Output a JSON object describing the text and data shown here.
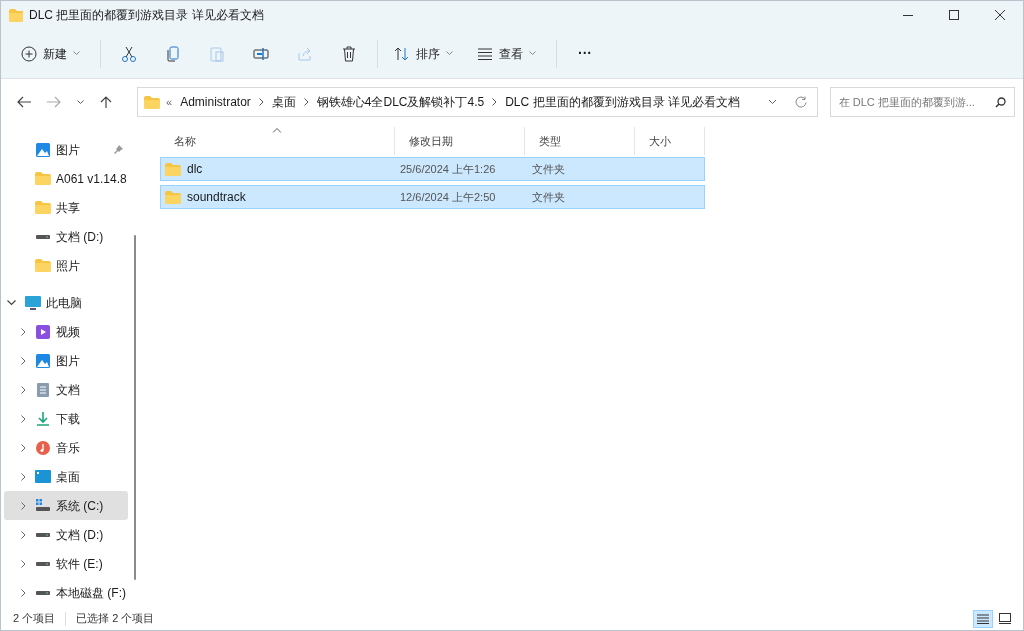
{
  "window": {
    "title": "DLC 把里面的都覆到游戏目录 详见必看文档"
  },
  "toolbar": [
    {
      "kind": "new",
      "label": "新建",
      "dropdown": true,
      "disabled": false
    },
    {
      "kind": "cut",
      "disabled": false
    },
    {
      "kind": "copy",
      "disabled": false
    },
    {
      "kind": "paste",
      "disabled": true
    },
    {
      "kind": "rename",
      "disabled": false
    },
    {
      "kind": "share",
      "disabled": true
    },
    {
      "kind": "delete",
      "disabled": false
    },
    {
      "kind": "sort",
      "label": "排序",
      "dropdown": true,
      "disabled": false
    },
    {
      "kind": "view",
      "label": "查看",
      "dropdown": true,
      "disabled": false
    },
    {
      "kind": "more",
      "label": "···",
      "disabled": false
    }
  ],
  "navigation": {
    "back_disabled": false,
    "forward_disabled": true
  },
  "address_bar": {
    "overflow": "«",
    "crumbs": [
      "Administrator",
      "桌面",
      "钢铁雄心4全DLC及解锁补丁4.5",
      "DLC 把里面的都覆到游戏目录 详见必看文档"
    ]
  },
  "search": {
    "placeholder": "在 DLC 把里面的都覆到游..."
  },
  "sidebar": {
    "quick_access": [
      {
        "kind": "pictures",
        "label": "图片",
        "pinned": true
      },
      {
        "kind": "folder",
        "label": "A061 v1.14.8",
        "pinned": false
      },
      {
        "kind": "folder",
        "label": "共享",
        "pinned": false
      },
      {
        "kind": "drive",
        "label": "文档 (D:)",
        "pinned": false
      },
      {
        "kind": "folder",
        "label": "照片",
        "pinned": false
      }
    ],
    "tree": [
      {
        "kind": "pc",
        "label": "此电脑",
        "expanded": true,
        "selected": false,
        "children": [
          {
            "kind": "videos",
            "label": "视频",
            "expanded": false,
            "selected": false
          },
          {
            "kind": "pictures",
            "label": "图片",
            "expanded": false,
            "selected": false
          },
          {
            "kind": "documents",
            "label": "文档",
            "expanded": false,
            "selected": false
          },
          {
            "kind": "downloads",
            "label": "下载",
            "expanded": false,
            "selected": false
          },
          {
            "kind": "music",
            "label": "音乐",
            "expanded": false,
            "selected": false
          },
          {
            "kind": "desktop",
            "label": "桌面",
            "expanded": false,
            "selected": false
          },
          {
            "kind": "system-drive",
            "label": "系统 (C:)",
            "expanded": false,
            "selected": true
          },
          {
            "kind": "drive",
            "label": "文档 (D:)",
            "expanded": false,
            "selected": false
          },
          {
            "kind": "drive",
            "label": "软件 (E:)",
            "expanded": false,
            "selected": false
          },
          {
            "kind": "drive",
            "label": "本地磁盘 (F:)",
            "expanded": false,
            "selected": false
          }
        ]
      }
    ]
  },
  "table": {
    "columns": [
      {
        "label": "名称",
        "sorted": true
      },
      {
        "label": "修改日期",
        "sorted": false
      },
      {
        "label": "类型",
        "sorted": false
      },
      {
        "label": "大小",
        "sorted": false
      }
    ],
    "rows": [
      {
        "name": "dlc",
        "modified": "25/6/2024 上午1:26",
        "type": "文件夹",
        "selected": true
      },
      {
        "name": "soundtrack",
        "modified": "12/6/2024 上午2:50",
        "type": "文件夹",
        "selected": true
      }
    ]
  },
  "status_bar": {
    "item_count": "2 个项目",
    "selection": "已选择 2 个项目",
    "view_modes": [
      {
        "kind": "details",
        "selected": true
      },
      {
        "kind": "tiles",
        "selected": false
      }
    ]
  }
}
